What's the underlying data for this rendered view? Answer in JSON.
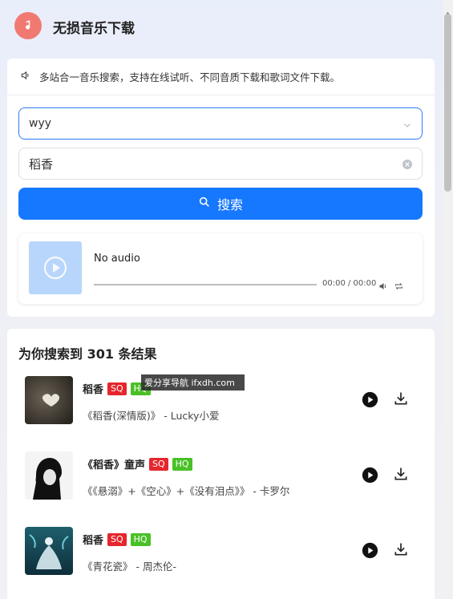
{
  "header": {
    "title": "无损音乐下载",
    "logo_icon": "music-note-icon"
  },
  "notice": {
    "text": "多站合一音乐搜索，支持在线试听、不同音质下载和歌词文件下载。",
    "icon": "speaker-icon"
  },
  "search": {
    "source_value": "wyy",
    "query_value": "稻香",
    "button_label": "搜索"
  },
  "player": {
    "title": "No audio",
    "time": "00:00 / 00:00"
  },
  "results": {
    "title": "为你搜索到 301 条结果",
    "items": [
      {
        "name": "稻香",
        "badges": [
          "SQ",
          "HQ"
        ],
        "subtitle": "《稻香(深情版)》 - Lucky小爱"
      },
      {
        "name": "《稻香》童声",
        "badges": [
          "SQ",
          "HQ"
        ],
        "subtitle": "《《悬溺》+《空心》+《没有泪点》》 - 卡罗尔"
      },
      {
        "name": "稻香",
        "badges": [
          "SQ",
          "HQ"
        ],
        "subtitle": "《青花瓷》 - 周杰伦-"
      }
    ]
  },
  "watermark": {
    "text": "爱分享导航 ifxdh.com"
  },
  "colors": {
    "accent": "#1677ff",
    "sq": "#e5262d",
    "hq": "#4ac027",
    "logo": "#f07a72"
  }
}
